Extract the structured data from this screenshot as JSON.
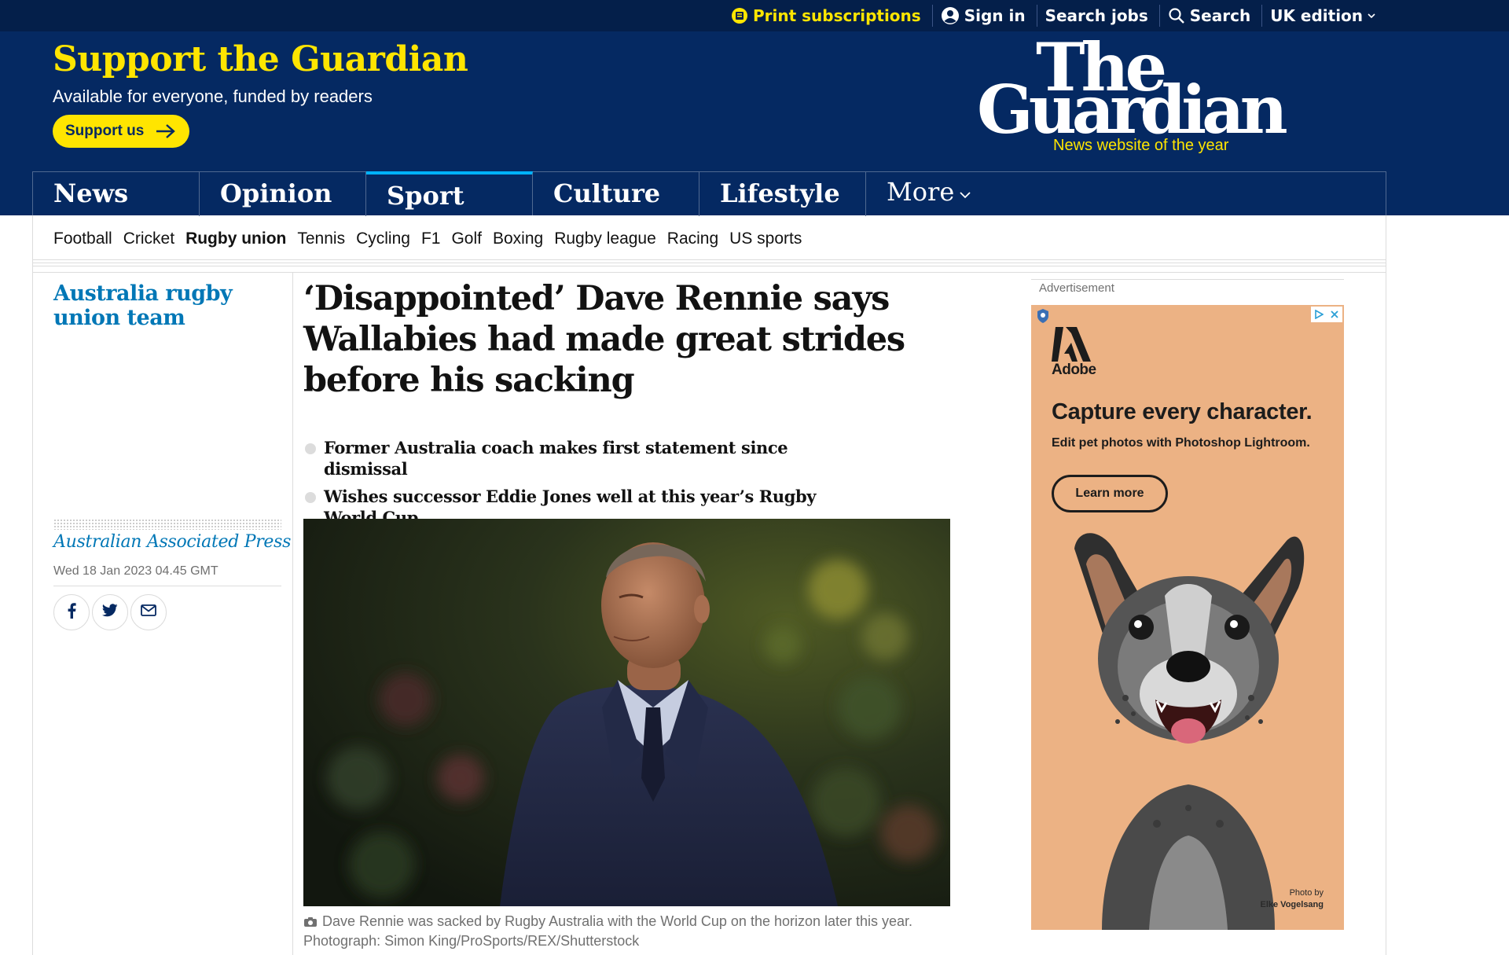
{
  "topbar": {
    "print_subscriptions": "Print subscriptions",
    "sign_in": "Sign in",
    "search_jobs": "Search jobs",
    "search": "Search",
    "edition": "UK edition"
  },
  "masthead": {
    "support_title": "Support the Guardian",
    "support_sub": "Available for everyone, funded by readers",
    "support_button": "Support us",
    "logo_line1": "The",
    "logo_line2": "Guardian",
    "logo_tagline": "News website of the year"
  },
  "pillars": [
    "News",
    "Opinion",
    "Sport",
    "Culture",
    "Lifestyle"
  ],
  "pillar_more": "More",
  "subnav": [
    "Football",
    "Cricket",
    "Rugby union",
    "Tennis",
    "Cycling",
    "F1",
    "Golf",
    "Boxing",
    "Rugby league",
    "Racing",
    "US sports"
  ],
  "article": {
    "series": "Australia rugby union team",
    "headline": "‘Disappointed’ Dave Rennie says Wallabies had made great strides before his sacking",
    "standfirst": [
      "Former Australia coach makes first statement since dismissal",
      "Wishes successor Eddie Jones well at this year’s Rugby World Cup"
    ],
    "byline": "Australian Associated Press",
    "date": "Wed 18 Jan 2023 04.45 GMT",
    "caption": "Dave Rennie was sacked by Rugby Australia with the World Cup on the horizon later this year. Photograph: Simon King/ProSports/REX/Shutterstock"
  },
  "advert": {
    "label": "Advertisement",
    "brand": "Adobe",
    "headline": "Capture every character.",
    "sub": "Edit pet photos with Photoshop Lightroom.",
    "button": "Learn more",
    "credit_line1": "Photo by",
    "credit_line2": "Elke Vogelsang"
  },
  "colors": {
    "brand_blue": "#052962",
    "topbar_blue": "#041f4a",
    "brand_yellow": "#ffe500",
    "sport_accent": "#00b2ff",
    "link_blue": "#0077b6",
    "ad_background": "#ecb284"
  }
}
